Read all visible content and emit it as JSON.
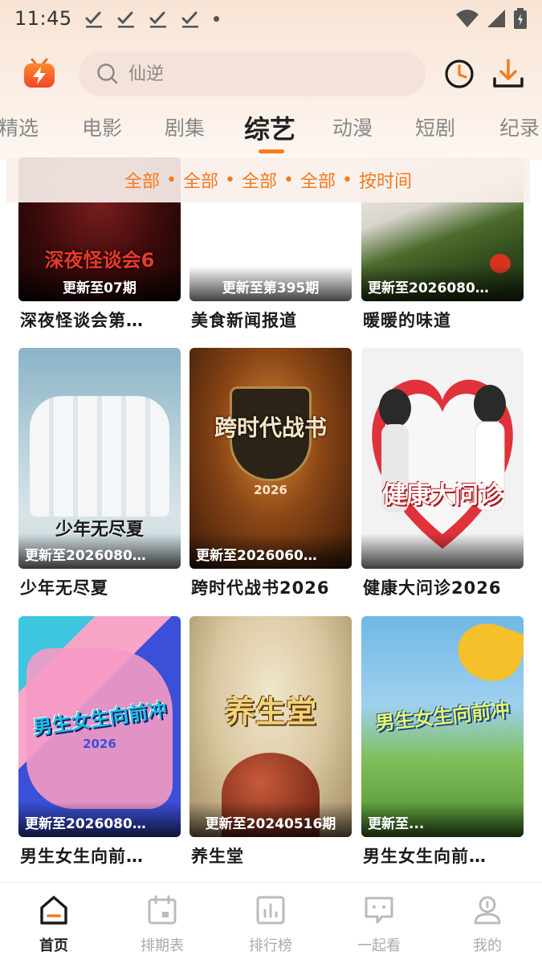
{
  "status_bar": {
    "time": "11:45"
  },
  "header": {
    "search_placeholder": "仙逆",
    "icons": {
      "logo": "app-logo-icon",
      "search": "search-icon",
      "history": "history-clock-icon",
      "download": "download-icon"
    }
  },
  "tabs": [
    {
      "label": "精选",
      "active": false
    },
    {
      "label": "电影",
      "active": false
    },
    {
      "label": "剧集",
      "active": false
    },
    {
      "label": "综艺",
      "active": true
    },
    {
      "label": "动漫",
      "active": false
    },
    {
      "label": "短剧",
      "active": false
    },
    {
      "label": "纪录",
      "active": false
    }
  ],
  "filters": [
    "全部",
    "全部",
    "全部",
    "全部",
    "按时间"
  ],
  "filter_separator": "•",
  "cards": [
    {
      "title": "深夜怪谈会第…",
      "badge": "更新至07期",
      "poster_text": "深夜怪谈会6"
    },
    {
      "title": "美食新闻报道",
      "badge": "更新至第395期"
    },
    {
      "title": "暖暖的味道",
      "badge": "更新至2026080…"
    },
    {
      "title": "少年无尽夏",
      "badge": "更新至2026080…",
      "poster_text": "少年无尽夏"
    },
    {
      "title": "跨时代战书2026",
      "badge": "更新至2026060…",
      "poster_text": "跨时代战书",
      "poster_subtext": "2026"
    },
    {
      "title": "健康大问诊2026",
      "badge": "",
      "poster_text": "健康大问诊"
    },
    {
      "title": "男生女生向前…",
      "badge": "更新至2026080…",
      "poster_text": "男生女生向前冲",
      "poster_subtext": "2026"
    },
    {
      "title": "养生堂",
      "badge": "更新至20240516期",
      "poster_text": "养生堂"
    },
    {
      "title": "男生女生向前…",
      "badge": "更新至...",
      "poster_text": "男生女生向前冲"
    }
  ],
  "bottom_nav": [
    {
      "label": "首页",
      "icon": "home-icon",
      "active": true
    },
    {
      "label": "排期表",
      "icon": "calendar-icon",
      "active": false
    },
    {
      "label": "排行榜",
      "icon": "ranking-icon",
      "active": false
    },
    {
      "label": "一起看",
      "icon": "watch-together-icon",
      "active": false
    },
    {
      "label": "我的",
      "icon": "profile-icon",
      "active": false
    }
  ],
  "colors": {
    "accent": "#f57a1f",
    "header_bg": "#f8e4d4",
    "search_bg": "#f3e3d8"
  }
}
